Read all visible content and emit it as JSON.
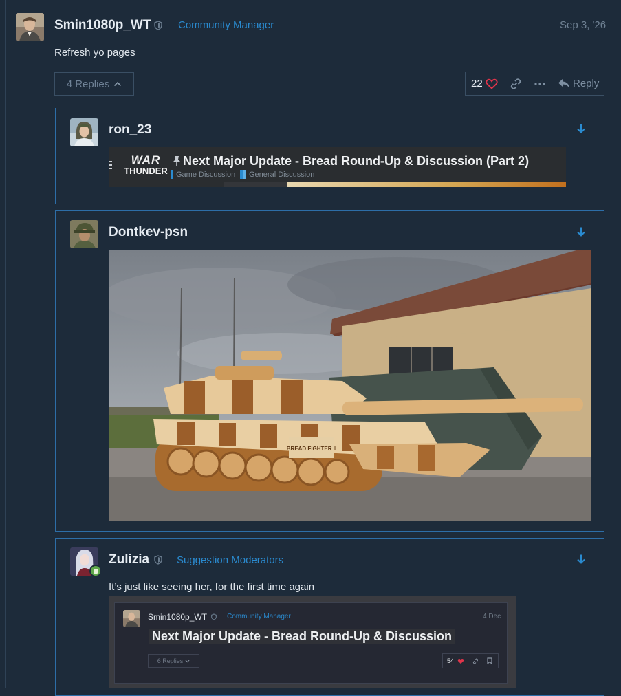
{
  "main_post": {
    "username": "Smin1080p_WT",
    "role": "Community Manager",
    "date": "Sep 3, '26",
    "body": "Refresh yo pages",
    "replies_label": "4 Replies",
    "like_count": "22",
    "reply_label": "Reply"
  },
  "replies": [
    {
      "username": "ron_23",
      "onebox": {
        "site_logo_top": "WAR",
        "site_logo_bottom": "THUNDER",
        "title": "Next Major Update - Bread Round-Up & Discussion (Part 2)",
        "category_1": "Game Discussion",
        "category_2": "General Discussion"
      }
    },
    {
      "username": "Dontkev-psn",
      "image_label": "BREAD FIGHTER II"
    },
    {
      "username": "Zulizia",
      "role": "Suggestion Moderators",
      "body": "It’s just like seeing her, for the first time again",
      "quoted": {
        "username": "Smin1080p_WT",
        "role": "Community Manager",
        "date": "4 Dec",
        "title": "Next Major Update - Bread Round-Up & Discussion",
        "replies_label": "6 Replies",
        "like_count": "54"
      }
    }
  ],
  "colors": {
    "background": "#1d2b3a",
    "accent": "#2a8bd0",
    "card_border": "#2d6ea8",
    "heart": "#e0344a"
  },
  "icons": [
    "shield-icon",
    "chevron-up-icon",
    "heart-icon",
    "link-icon",
    "more-icon",
    "reply-icon",
    "arrow-down-icon",
    "pin-icon"
  ]
}
